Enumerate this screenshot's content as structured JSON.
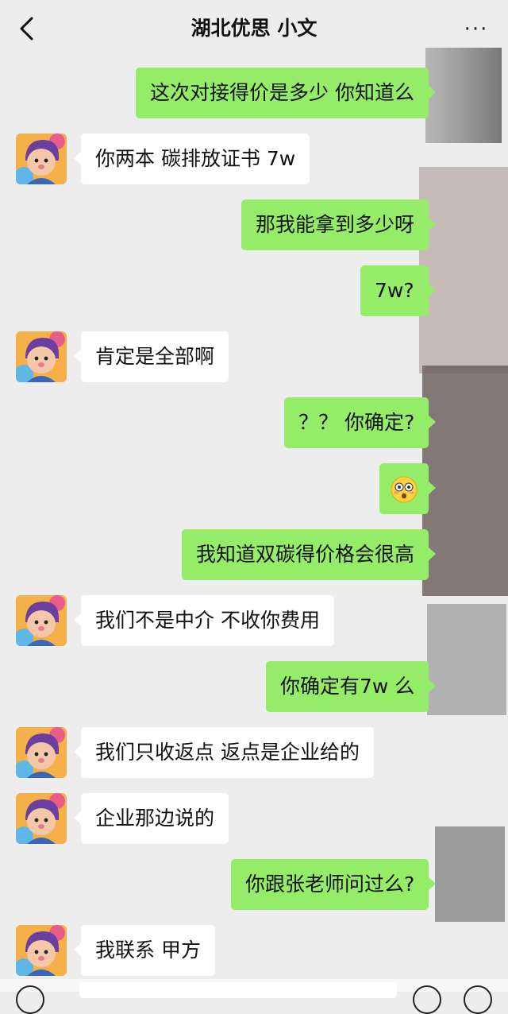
{
  "header": {
    "title": "湖北优思 小文",
    "back_icon": "chevron-left-icon",
    "more_icon": "more-horizontal-icon",
    "more_glyph": "···"
  },
  "colors": {
    "background": "#ededed",
    "my_bubble": "#95ec69",
    "their_bubble": "#ffffff"
  },
  "messages": [
    {
      "sender": "me",
      "text": "这次对接得价是多少 你知道么"
    },
    {
      "sender": "other",
      "text": "你两本 碳排放证书 7w"
    },
    {
      "sender": "me",
      "text": "那我能拿到多少呀"
    },
    {
      "sender": "me",
      "text": "7w?"
    },
    {
      "sender": "other",
      "text": "肯定是全部啊"
    },
    {
      "sender": "me",
      "text": "？？ 你确定?"
    },
    {
      "sender": "me",
      "text": "",
      "emoji": "flushed-face-emoji"
    },
    {
      "sender": "me",
      "text": "我知道双碳得价格会很高"
    },
    {
      "sender": "other",
      "text": "我们不是中介 不收你费用"
    },
    {
      "sender": "me",
      "text": "你确定有7w 么"
    },
    {
      "sender": "other",
      "text": "我们只收返点 返点是企业给的"
    },
    {
      "sender": "other",
      "text": "企业那边说的"
    },
    {
      "sender": "me",
      "text": "你跟张老师问过么?"
    },
    {
      "sender": "other",
      "text": "我联系 甲方"
    }
  ]
}
